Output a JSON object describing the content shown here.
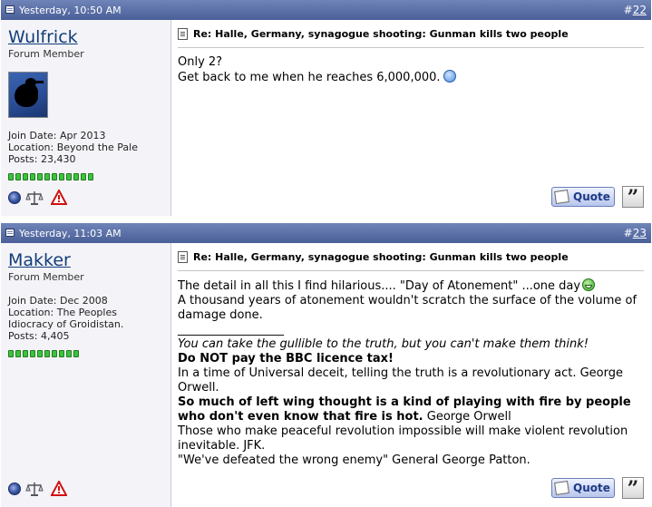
{
  "posts": [
    {
      "date": "Yesterday, 10:50 AM",
      "number": "22",
      "username": "Wulfrick",
      "user_title": "Forum Member",
      "join_date": "Join Date: Apr 2013",
      "location": "Location: Beyond the Pale",
      "posts_count": "Posts: 23,430",
      "reputation_pips": 12,
      "post_title": "Re: Halle, Germany, synagogue shooting: Gunman kills two people",
      "message": [
        "Only 2?",
        "Get back to me when he reaches 6,000,000."
      ],
      "quote_label": "Quote"
    },
    {
      "date": "Yesterday, 11:03 AM",
      "number": "23",
      "username": "Makker",
      "user_title": "Forum Member",
      "join_date": "Join Date: Dec 2008",
      "location": "Location: The Peoples",
      "location_cont": "Idiocracy of Groidistan.",
      "posts_count": "Posts: 4,405",
      "reputation_pips": 10,
      "post_title": "Re: Halle, Germany, synagogue shooting: Gunman kills two people",
      "message": {
        "line1": "The detail in all this I find hilarious.... \"Day of Atonement\" ...one day",
        "line2": "A thousand years of atonement wouldn't scratch the surface of the volume of damage done.",
        "divider": "__________________",
        "sig1": "You can take the gullible to the truth, but you can't make them think!",
        "sig2": "Do NOT pay the BBC licence tax!",
        "sig3": "In a time of Universal deceit, telling the truth is a revolutionary act. George Orwell.",
        "sig4_bold": "So much of left wing thought is a kind of playing with fire by people who don't even know that fire is hot.",
        "sig4_rest": " George Orwell",
        "sig5": "Those who make peaceful revolution impossible will make violent revolution inevitable. JFK.",
        "sig6": "\"We've defeated the wrong enemy\" General George Patton."
      },
      "quote_label": "Quote"
    }
  ],
  "icons": {
    "status": "online-status-icon",
    "reputation": "scales-icon",
    "report": "warning-icon",
    "multiquote": "multiquote-icon"
  },
  "colors": {
    "header_bg": "#4a5f98",
    "username": "#123d7a",
    "rep_pip": "#3cc33c"
  }
}
